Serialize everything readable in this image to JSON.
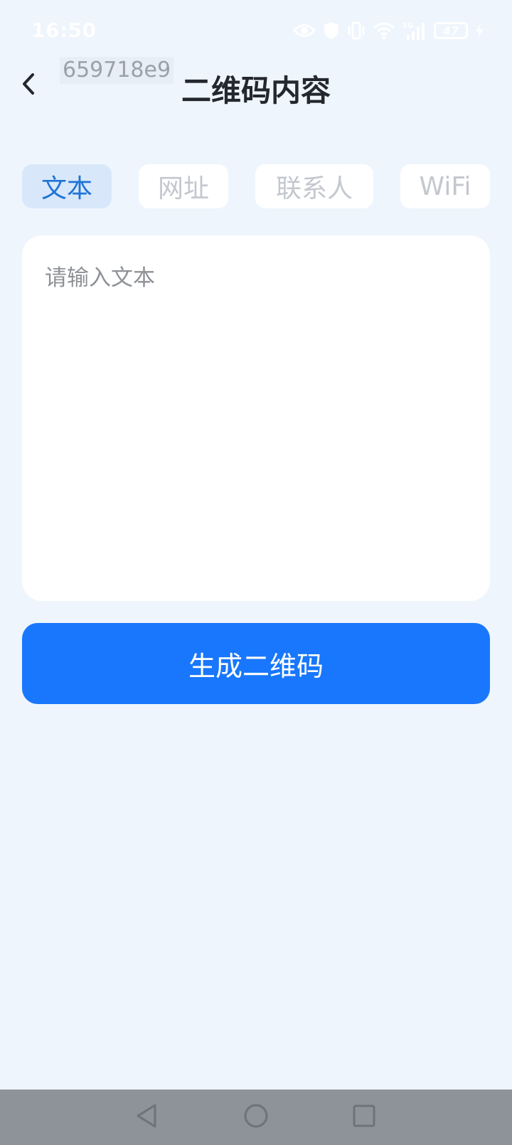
{
  "status_bar": {
    "time": "16:50",
    "battery_level": "47",
    "icons": [
      "eye-icon",
      "shield-icon",
      "vibrate-icon",
      "wifi-icon",
      "signal-5g-icon",
      "battery-icon",
      "charging-icon"
    ]
  },
  "header": {
    "watermark": "659718e9",
    "title": "二维码内容",
    "back_icon": "chevron-left-icon"
  },
  "tabs": [
    {
      "label": "文本",
      "active": true
    },
    {
      "label": "网址",
      "active": false
    },
    {
      "label": "联系人",
      "active": false
    },
    {
      "label": "WiFi",
      "active": false
    }
  ],
  "input": {
    "value": "",
    "placeholder": "请输入文本"
  },
  "generate_button": {
    "label": "生成二维码"
  },
  "nav_bar": {
    "icons": [
      "back-triangle-icon",
      "home-circle-icon",
      "recents-square-icon"
    ]
  },
  "colors": {
    "background": "#eef5fd",
    "primary": "#1877fc",
    "tab_active_bg": "#d8e8fa",
    "tab_active_text": "#1f74d6",
    "tab_inactive_text": "#c3c7ce",
    "nav_bar": "#8e9299"
  }
}
